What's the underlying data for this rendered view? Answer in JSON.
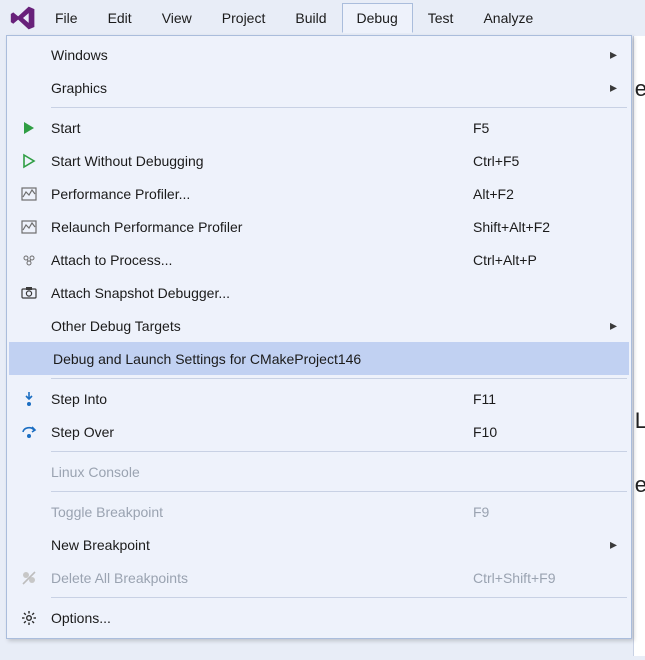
{
  "menubar": {
    "items": [
      {
        "label": "File"
      },
      {
        "label": "Edit"
      },
      {
        "label": "View"
      },
      {
        "label": "Project"
      },
      {
        "label": "Build"
      },
      {
        "label": "Debug",
        "open": true
      },
      {
        "label": "Test"
      },
      {
        "label": "Analyze"
      }
    ]
  },
  "dropdown": {
    "items": [
      {
        "type": "item",
        "icon": "",
        "label": "Windows",
        "shortcut": "",
        "submenu": true
      },
      {
        "type": "item",
        "icon": "",
        "label": "Graphics",
        "shortcut": "",
        "submenu": true
      },
      {
        "type": "sep"
      },
      {
        "type": "item",
        "icon": "start-icon",
        "label": "Start",
        "shortcut": "F5"
      },
      {
        "type": "item",
        "icon": "start-outline-icon",
        "label": "Start Without Debugging",
        "shortcut": "Ctrl+F5"
      },
      {
        "type": "item",
        "icon": "profiler-icon",
        "label": "Performance Profiler...",
        "shortcut": "Alt+F2"
      },
      {
        "type": "item",
        "icon": "profiler-icon",
        "label": "Relaunch Performance Profiler",
        "shortcut": "Shift+Alt+F2"
      },
      {
        "type": "item",
        "icon": "attach-icon",
        "label": "Attach to Process...",
        "shortcut": "Ctrl+Alt+P"
      },
      {
        "type": "item",
        "icon": "snapshot-icon",
        "label": "Attach Snapshot Debugger...",
        "shortcut": ""
      },
      {
        "type": "item",
        "icon": "",
        "label": "Other Debug Targets",
        "shortcut": "",
        "submenu": true
      },
      {
        "type": "item",
        "icon": "",
        "label": "Debug and Launch Settings for CMakeProject146",
        "shortcut": "",
        "highlighted": true
      },
      {
        "type": "sep"
      },
      {
        "type": "item",
        "icon": "step-into-icon",
        "label": "Step Into",
        "shortcut": "F11"
      },
      {
        "type": "item",
        "icon": "step-over-icon",
        "label": "Step Over",
        "shortcut": "F10"
      },
      {
        "type": "sep"
      },
      {
        "type": "item",
        "icon": "",
        "label": "Linux Console",
        "shortcut": "",
        "disabled": true
      },
      {
        "type": "sep"
      },
      {
        "type": "item",
        "icon": "",
        "label": "Toggle Breakpoint",
        "shortcut": "F9",
        "disabled": true
      },
      {
        "type": "item",
        "icon": "",
        "label": "New Breakpoint",
        "shortcut": "",
        "submenu": true
      },
      {
        "type": "item",
        "icon": "delete-breakpoints-icon",
        "label": "Delete All Breakpoints",
        "shortcut": "Ctrl+Shift+F9",
        "disabled": true
      },
      {
        "type": "sep"
      },
      {
        "type": "item",
        "icon": "gear-icon",
        "label": "Options...",
        "shortcut": ""
      }
    ]
  },
  "colors": {
    "accent": "#68217a",
    "green": "#2f9e44",
    "blue": "#1b6ec2",
    "gray": "#6e6e6e",
    "highlight": "#c1d1f2"
  },
  "background_peek": {
    "letters": [
      "e",
      "L",
      "e"
    ]
  }
}
